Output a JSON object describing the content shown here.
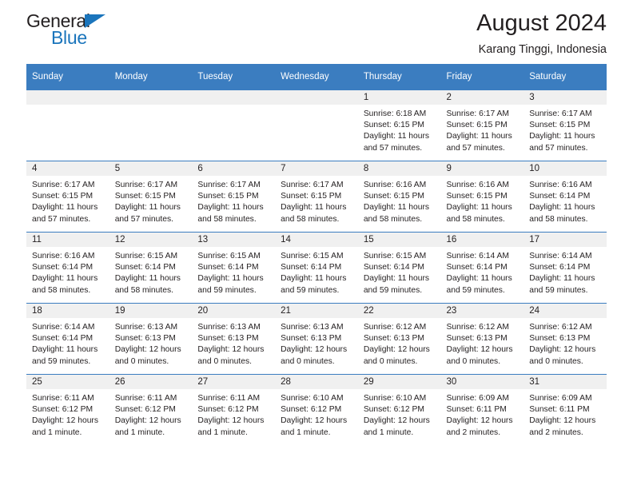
{
  "brand": {
    "name_top": "General",
    "name_bottom": "Blue",
    "accent_color": "#1b75bc"
  },
  "header": {
    "title": "August 2024",
    "subtitle": "Karang Tinggi, Indonesia"
  },
  "theme": {
    "header_bg": "#3b7dc0",
    "daynum_band_bg": "#f0f0f0",
    "text_color": "#231f20"
  },
  "weekday_headers": [
    "Sunday",
    "Monday",
    "Tuesday",
    "Wednesday",
    "Thursday",
    "Friday",
    "Saturday"
  ],
  "weeks": [
    [
      {
        "day": "",
        "lines": []
      },
      {
        "day": "",
        "lines": []
      },
      {
        "day": "",
        "lines": []
      },
      {
        "day": "",
        "lines": []
      },
      {
        "day": "1",
        "lines": [
          "Sunrise: 6:18 AM",
          "Sunset: 6:15 PM",
          "Daylight: 11 hours",
          "and 57 minutes."
        ]
      },
      {
        "day": "2",
        "lines": [
          "Sunrise: 6:17 AM",
          "Sunset: 6:15 PM",
          "Daylight: 11 hours",
          "and 57 minutes."
        ]
      },
      {
        "day": "3",
        "lines": [
          "Sunrise: 6:17 AM",
          "Sunset: 6:15 PM",
          "Daylight: 11 hours",
          "and 57 minutes."
        ]
      }
    ],
    [
      {
        "day": "4",
        "lines": [
          "Sunrise: 6:17 AM",
          "Sunset: 6:15 PM",
          "Daylight: 11 hours",
          "and 57 minutes."
        ]
      },
      {
        "day": "5",
        "lines": [
          "Sunrise: 6:17 AM",
          "Sunset: 6:15 PM",
          "Daylight: 11 hours",
          "and 57 minutes."
        ]
      },
      {
        "day": "6",
        "lines": [
          "Sunrise: 6:17 AM",
          "Sunset: 6:15 PM",
          "Daylight: 11 hours",
          "and 58 minutes."
        ]
      },
      {
        "day": "7",
        "lines": [
          "Sunrise: 6:17 AM",
          "Sunset: 6:15 PM",
          "Daylight: 11 hours",
          "and 58 minutes."
        ]
      },
      {
        "day": "8",
        "lines": [
          "Sunrise: 6:16 AM",
          "Sunset: 6:15 PM",
          "Daylight: 11 hours",
          "and 58 minutes."
        ]
      },
      {
        "day": "9",
        "lines": [
          "Sunrise: 6:16 AM",
          "Sunset: 6:15 PM",
          "Daylight: 11 hours",
          "and 58 minutes."
        ]
      },
      {
        "day": "10",
        "lines": [
          "Sunrise: 6:16 AM",
          "Sunset: 6:14 PM",
          "Daylight: 11 hours",
          "and 58 minutes."
        ]
      }
    ],
    [
      {
        "day": "11",
        "lines": [
          "Sunrise: 6:16 AM",
          "Sunset: 6:14 PM",
          "Daylight: 11 hours",
          "and 58 minutes."
        ]
      },
      {
        "day": "12",
        "lines": [
          "Sunrise: 6:15 AM",
          "Sunset: 6:14 PM",
          "Daylight: 11 hours",
          "and 58 minutes."
        ]
      },
      {
        "day": "13",
        "lines": [
          "Sunrise: 6:15 AM",
          "Sunset: 6:14 PM",
          "Daylight: 11 hours",
          "and 59 minutes."
        ]
      },
      {
        "day": "14",
        "lines": [
          "Sunrise: 6:15 AM",
          "Sunset: 6:14 PM",
          "Daylight: 11 hours",
          "and 59 minutes."
        ]
      },
      {
        "day": "15",
        "lines": [
          "Sunrise: 6:15 AM",
          "Sunset: 6:14 PM",
          "Daylight: 11 hours",
          "and 59 minutes."
        ]
      },
      {
        "day": "16",
        "lines": [
          "Sunrise: 6:14 AM",
          "Sunset: 6:14 PM",
          "Daylight: 11 hours",
          "and 59 minutes."
        ]
      },
      {
        "day": "17",
        "lines": [
          "Sunrise: 6:14 AM",
          "Sunset: 6:14 PM",
          "Daylight: 11 hours",
          "and 59 minutes."
        ]
      }
    ],
    [
      {
        "day": "18",
        "lines": [
          "Sunrise: 6:14 AM",
          "Sunset: 6:14 PM",
          "Daylight: 11 hours",
          "and 59 minutes."
        ]
      },
      {
        "day": "19",
        "lines": [
          "Sunrise: 6:13 AM",
          "Sunset: 6:13 PM",
          "Daylight: 12 hours",
          "and 0 minutes."
        ]
      },
      {
        "day": "20",
        "lines": [
          "Sunrise: 6:13 AM",
          "Sunset: 6:13 PM",
          "Daylight: 12 hours",
          "and 0 minutes."
        ]
      },
      {
        "day": "21",
        "lines": [
          "Sunrise: 6:13 AM",
          "Sunset: 6:13 PM",
          "Daylight: 12 hours",
          "and 0 minutes."
        ]
      },
      {
        "day": "22",
        "lines": [
          "Sunrise: 6:12 AM",
          "Sunset: 6:13 PM",
          "Daylight: 12 hours",
          "and 0 minutes."
        ]
      },
      {
        "day": "23",
        "lines": [
          "Sunrise: 6:12 AM",
          "Sunset: 6:13 PM",
          "Daylight: 12 hours",
          "and 0 minutes."
        ]
      },
      {
        "day": "24",
        "lines": [
          "Sunrise: 6:12 AM",
          "Sunset: 6:13 PM",
          "Daylight: 12 hours",
          "and 0 minutes."
        ]
      }
    ],
    [
      {
        "day": "25",
        "lines": [
          "Sunrise: 6:11 AM",
          "Sunset: 6:12 PM",
          "Daylight: 12 hours",
          "and 1 minute."
        ]
      },
      {
        "day": "26",
        "lines": [
          "Sunrise: 6:11 AM",
          "Sunset: 6:12 PM",
          "Daylight: 12 hours",
          "and 1 minute."
        ]
      },
      {
        "day": "27",
        "lines": [
          "Sunrise: 6:11 AM",
          "Sunset: 6:12 PM",
          "Daylight: 12 hours",
          "and 1 minute."
        ]
      },
      {
        "day": "28",
        "lines": [
          "Sunrise: 6:10 AM",
          "Sunset: 6:12 PM",
          "Daylight: 12 hours",
          "and 1 minute."
        ]
      },
      {
        "day": "29",
        "lines": [
          "Sunrise: 6:10 AM",
          "Sunset: 6:12 PM",
          "Daylight: 12 hours",
          "and 1 minute."
        ]
      },
      {
        "day": "30",
        "lines": [
          "Sunrise: 6:09 AM",
          "Sunset: 6:11 PM",
          "Daylight: 12 hours",
          "and 2 minutes."
        ]
      },
      {
        "day": "31",
        "lines": [
          "Sunrise: 6:09 AM",
          "Sunset: 6:11 PM",
          "Daylight: 12 hours",
          "and 2 minutes."
        ]
      }
    ]
  ]
}
